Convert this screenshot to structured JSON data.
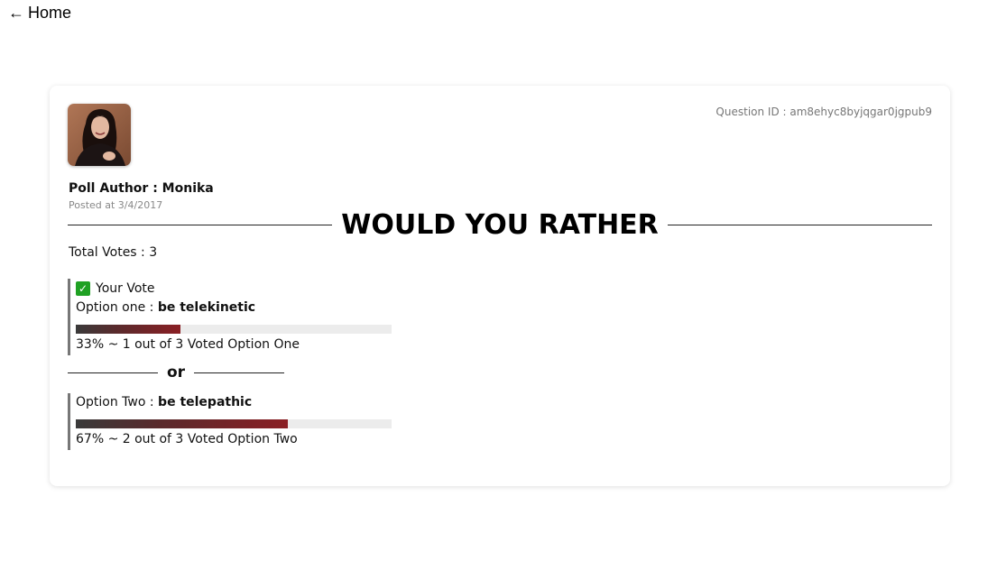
{
  "nav": {
    "home_arrow": "←",
    "home_label": "Home"
  },
  "poll": {
    "question_id_text": "Question ID : am8ehyc8byjqgar0jgpub9",
    "author_text": "Poll Author : Monika",
    "posted_text": "Posted at 3/4/2017",
    "title": "WOULD YOU RATHER",
    "total_votes_text": "Total Votes : 3",
    "your_vote_label": "Your Vote",
    "or_label": "or",
    "option_one": {
      "prefix": "Option one : ",
      "text": "be telekinetic",
      "percent": 33,
      "stat_text": "33% ~ 1 out of 3 Voted Option One",
      "user_voted": true
    },
    "option_two": {
      "prefix": "Option Two : ",
      "text": "be telepathic",
      "percent": 67,
      "stat_text": "67% ~ 2 out of 3 Voted Option Two",
      "user_voted": false
    }
  },
  "colors": {
    "check": "#1fa123",
    "bar_dark": "#3a3a3a",
    "bar_red": "#8a1f24",
    "bar_track": "#ececec"
  }
}
